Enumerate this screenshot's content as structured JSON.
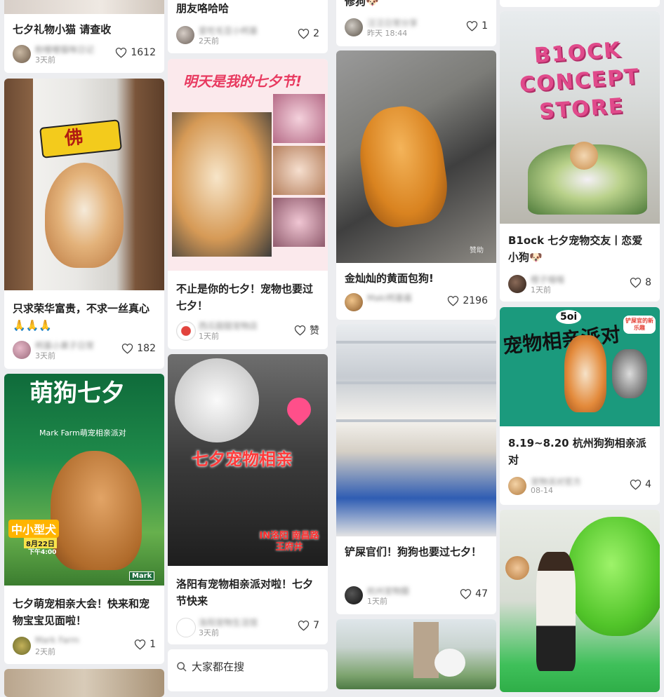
{
  "feed": {
    "col1": [
      {
        "title": "七夕礼物小猫 请查收",
        "user": "粉嘟嘟猫咪日记",
        "time": "3天前",
        "likes": "1612"
      },
      {
        "title": "只求荣华富贵，不求一丝真心🙏🙏🙏",
        "user": "柯基小果子日常",
        "time": "3天前",
        "likes": "182",
        "image_text": "佛"
      },
      {
        "title": "七夕萌宠相亲大会！快来和宠物宝宝见面啦！",
        "user": "Mark Farm",
        "time": "2天前",
        "likes": "1",
        "image_text": {
          "headline": "萌狗七夕",
          "sub": "Mark Farm萌宠相亲派对",
          "badge": "中小型犬",
          "date": "8月22日",
          "time": "下午4:00",
          "brand": "Mark"
        }
      }
    ],
    "col2": [
      {
        "title": "朋友咯哈哈",
        "user": "爱吃毛豆小柯基",
        "time": "2天前",
        "likes": "2"
      },
      {
        "title": "不止是你的七夕！宠物也要过七夕！",
        "user": "西瓜甜甜宠物店",
        "time": "1天前",
        "likes": "赞",
        "image_text": "明天是我的七夕节!"
      },
      {
        "title": "洛阳有宠物相亲派对啦！七夕节快来",
        "user": "洛阳宠物生活馆",
        "time": "3天前",
        "likes": "7",
        "image_text": {
          "headline": "七夕宠物相亲",
          "sub": "IN洛阳 南昌路王府井"
        }
      }
    ],
    "col3": [
      {
        "title": "修狗🐶",
        "user": "汪汪日常分享",
        "time": "昨天 18:44",
        "likes": "1"
      },
      {
        "title": "金灿灿的黄面包狗!",
        "user": "Maki柯基酱",
        "time": "",
        "likes": "2196",
        "image_text": "赞助"
      },
      {
        "title": "铲屎官们！狗狗也要过七夕！",
        "user": "杭州宠物圈",
        "time": "1天前",
        "likes": "47"
      }
    ],
    "col4": [
      {
        "title": "B1ock 七夕宠物交友丨恋爱小狗🐶",
        "user": "橙子喵喵",
        "time": "1天前",
        "likes": "8",
        "image_text": "B1OCK CONCEPT STORE"
      },
      {
        "title": "8.19~8.20 杭州狗狗相亲派对",
        "user": "宠物派对官方",
        "time": "08-14",
        "likes": "4",
        "image_text": {
          "headline": "宠物相亲派对",
          "brand": "5oi",
          "tag": "铲屎官的新乐趣"
        }
      }
    ]
  },
  "search": {
    "label": "大家都在搜"
  },
  "colors": {
    "like_text": "#333333",
    "card_bg": "#ffffff",
    "page_bg": "#ecedf0"
  }
}
